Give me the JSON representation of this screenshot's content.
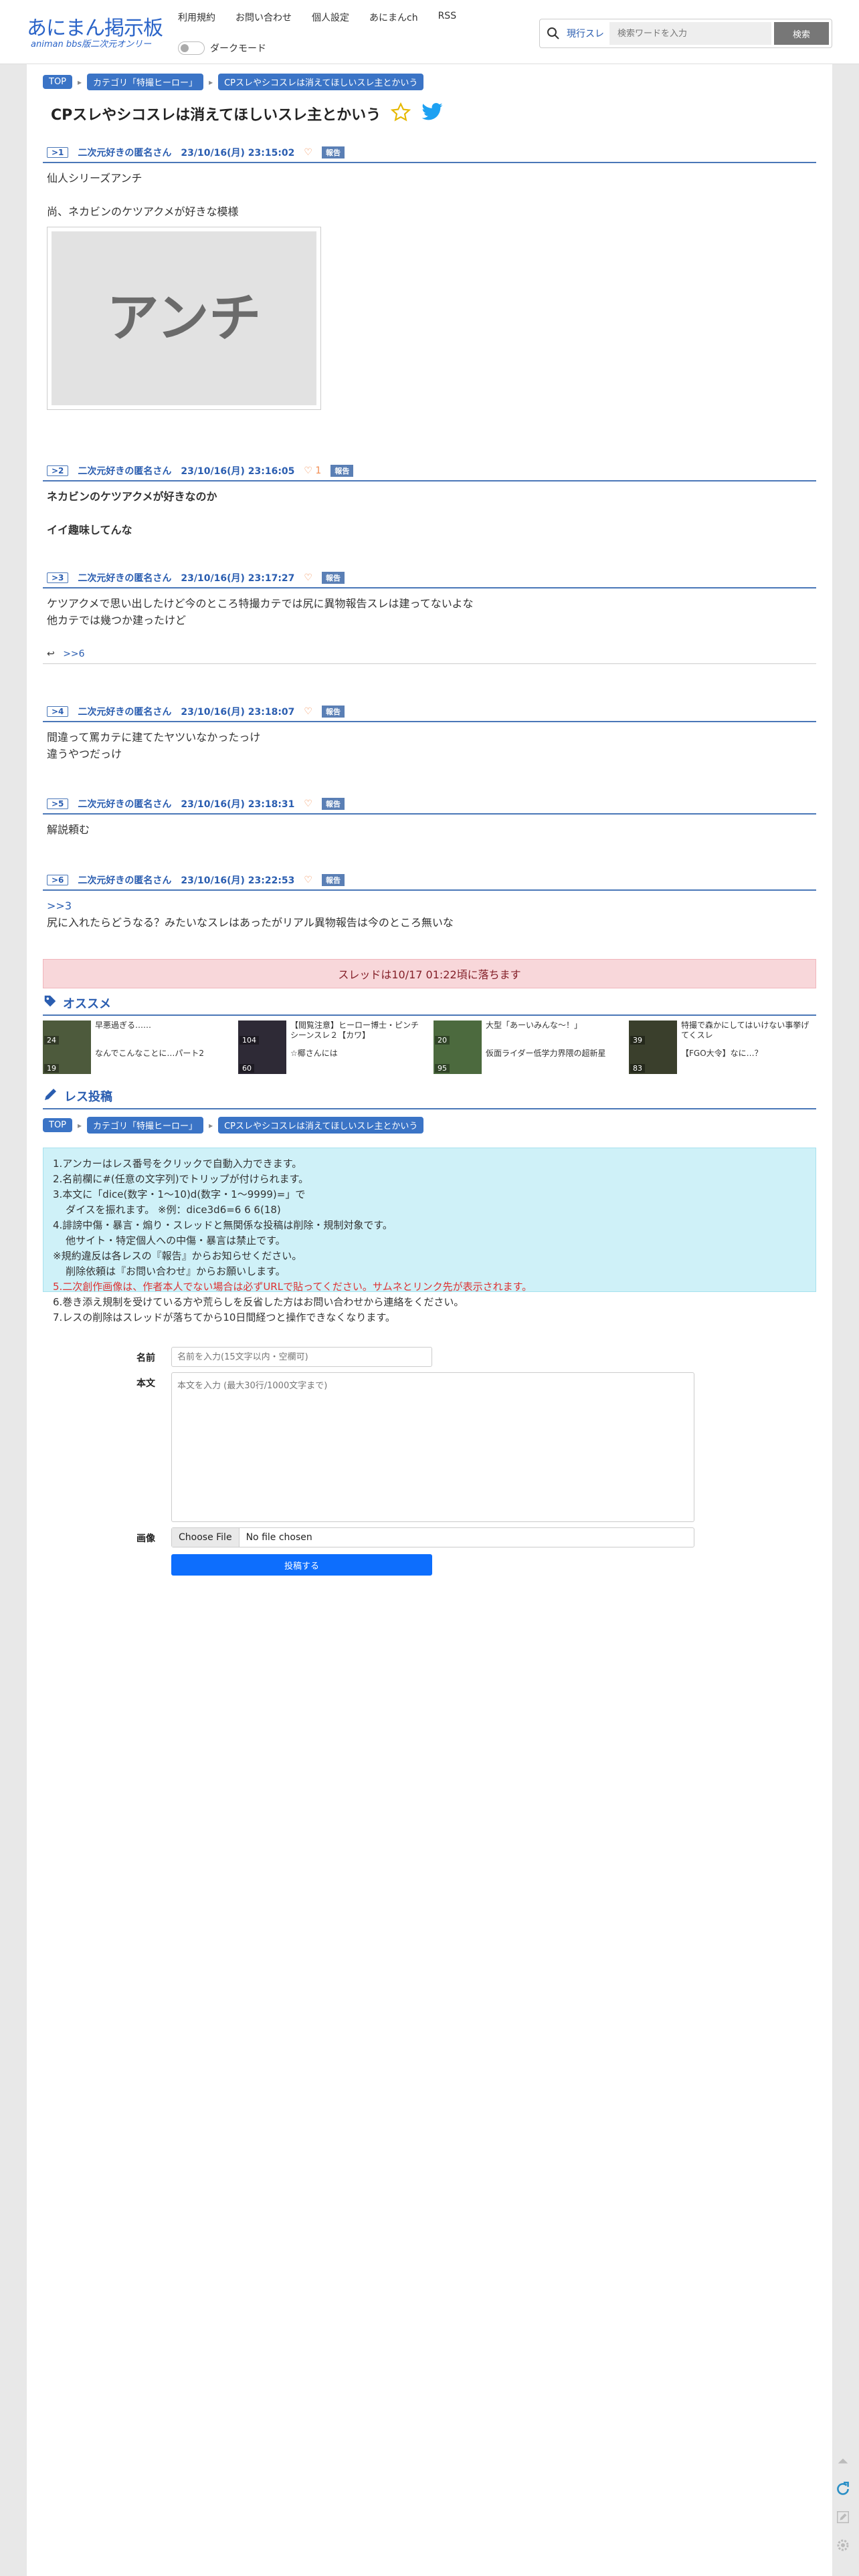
{
  "header": {
    "logo_main": "あにまん掲示板",
    "logo_sub": "animan bbs版二次元オンリー",
    "nav": [
      "利用規約",
      "お問い合わせ",
      "個人設定",
      "あにまんch",
      "RSS"
    ],
    "darkmode_label": "ダークモード",
    "search_scope": "現行スレ",
    "search_placeholder": "検索ワードを入力",
    "search_button": "検索"
  },
  "breadcrumb": [
    "TOP",
    "カテゴリ「特撮ヒーロー」",
    "CPスレやシコスレは消えてほしいスレ主とかいう"
  ],
  "thread": {
    "title": "CPスレやシコスレは消えてほしいスレ主とかいう"
  },
  "posts": [
    {
      "no": ">1",
      "name": "二次元好きの匿名さん",
      "date": "23/10/16(月) 23:15:02",
      "likes": "",
      "report": "報告",
      "lines": [
        "仙人シリーズアンチ",
        "",
        "尚、ネカビンのケツアクメが好きな模様"
      ],
      "image_text": "アンチ"
    },
    {
      "no": ">2",
      "name": "二次元好きの匿名さん",
      "date": "23/10/16(月) 23:16:05",
      "likes": "1",
      "report": "報告",
      "lines": [
        "ネカビンのケツアクメが好きなのか",
        "",
        "イイ趣味してんな"
      ]
    },
    {
      "no": ">3",
      "name": "二次元好きの匿名さん",
      "date": "23/10/16(月) 23:17:27",
      "likes": "",
      "report": "報告",
      "lines": [
        "ケツアクメで思い出したけど今のところ特撮カテでは尻に異物報告スレは建ってないよな",
        "他カテでは幾つか建ったけど"
      ],
      "reply_ref": ">>6"
    },
    {
      "no": ">4",
      "name": "二次元好きの匿名さん",
      "date": "23/10/16(月) 23:18:07",
      "likes": "",
      "report": "報告",
      "lines": [
        "間違って罵カテに建てたヤツいなかったっけ",
        "違うやつだっけ"
      ]
    },
    {
      "no": ">5",
      "name": "二次元好きの匿名さん",
      "date": "23/10/16(月) 23:18:31",
      "likes": "",
      "report": "報告",
      "lines": [
        "解説頼む"
      ]
    },
    {
      "no": ">6",
      "name": "二次元好きの匿名さん",
      "date": "23/10/16(月) 23:22:53",
      "likes": "",
      "report": "報告",
      "anchor": ">>3",
      "lines": [
        "尻に入れたらどうなる？みたいなスレはあったがリアル異物報告は今のところ無いな"
      ]
    }
  ],
  "drop_notice": "スレッドは10/17 01:22頃に落ちます",
  "recommend": {
    "title": "オススメ",
    "items": [
      {
        "title": "早悪過ぎる……",
        "sub": "なんでこんなことに…パート2",
        "count_a": "24",
        "count_b": "19",
        "color": "#4d5a3c"
      },
      {
        "title": "【閲覧注意】ヒーロー博士・ピンチシーンスレ２【カワ】",
        "sub": "☆椰さんには",
        "count_a": "104",
        "count_b": "60",
        "color": "#2e2a36"
      },
      {
        "title": "大型「あーいみんな～！」",
        "sub": "仮面ライダー低学力界隈の超新星",
        "count_a": "20",
        "count_b": "95",
        "color": "#4c6a3e"
      },
      {
        "title": "特撮で森かにしてはいけない事挙げてくスレ",
        "sub": "【FGO大令】なに…？",
        "count_a": "39",
        "count_b": "83",
        "color": "#3a3f2c"
      }
    ]
  },
  "reply_form": {
    "title": "レス投稿",
    "rules": [
      "1.アンカーはレス番号をクリックで自動入力できます。",
      "2.名前欄に#(任意の文字列)でトリップが付けられます。",
      "3.本文に「dice(数字・1〜10)d(数字・1〜9999)=」で",
      "    ダイスを振れます。 ※例：dice3d6=6 6 6(18)",
      "4.誹謗中傷・暴言・煽り・スレッドと無関係な投稿は削除・規制対象です。",
      "    他サイト・特定個人への中傷・暴言は禁止です。",
      "※規約違反は各レスの『報告』からお知らせください。",
      "    削除依頼は『お問い合わせ』からお願いします。",
      "5.二次創作画像は、作者本人でない場合は必ずURLで貼ってください。サムネとリンク先が表示されます。",
      "6.巻き添え規制を受けている方や荒らしを反省した方はお問い合わせから連絡をください。",
      "7.レスの削除はスレッドが落ちてから10日間経つと操作できなくなります。"
    ],
    "name_label": "名前",
    "name_placeholder": "名前を入力(15文字以内・空欄可)",
    "body_label": "本文",
    "body_placeholder": "本文を入力 (最大30行/1000文字まで)",
    "image_label": "画像",
    "file_button": "Choose File",
    "file_status": "No file chosen",
    "submit": "投稿する"
  },
  "colors": {
    "accent": "#2a5db0",
    "crumb": "#3b74c6",
    "notice_bg": "#f8d7da",
    "rules_bg": "#cff1f8",
    "submit": "#0d6efd"
  }
}
